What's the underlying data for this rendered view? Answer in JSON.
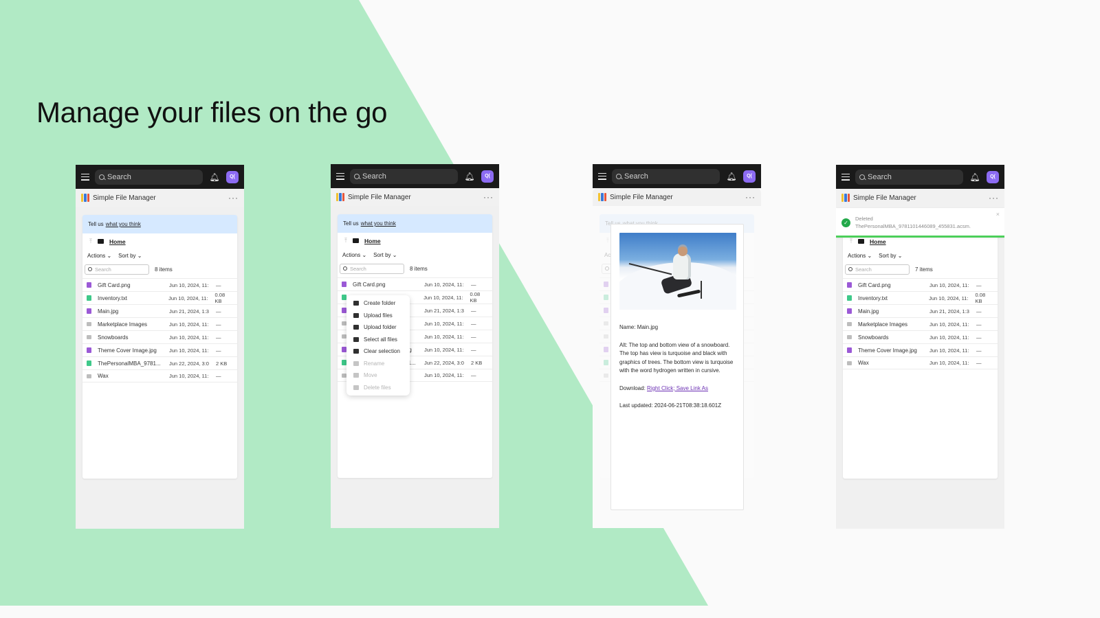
{
  "page": {
    "headline": "Manage your files on the go",
    "colors": {
      "green": "#b1eac5",
      "background": "#fafafa",
      "accent": "#8c6bf2",
      "success": "#23a94a"
    }
  },
  "common": {
    "search_placeholder": "Search",
    "avatar_initials": "Q(",
    "app_name": "Simple File Manager",
    "more_label": "···",
    "banner_prefix": "Tell us",
    "banner_link": "what you think",
    "breadcrumb_home": "Home",
    "actions_label": "Actions ⌄",
    "sort_label": "Sort by ⌄",
    "list_search_placeholder": "Search",
    "icons": {
      "menu": "hamburger-icon",
      "search": "search-icon",
      "bell": "bell-icon",
      "up": "up-arrow-icon",
      "folder": "folder-icon",
      "more": "more-icon"
    }
  },
  "screens": [
    {
      "id": "file-list",
      "item_count": "8 items",
      "files": [
        {
          "name": "Gift Card.png",
          "type": "img",
          "date": "Jun 10, 2024, 11:",
          "size": "—"
        },
        {
          "name": "Inventory.txt",
          "type": "txt",
          "date": "Jun 10, 2024, 11:",
          "size": "0.08 KB"
        },
        {
          "name": "Main.jpg",
          "type": "img",
          "date": "Jun 21, 2024, 1:3",
          "size": "—"
        },
        {
          "name": "Marketplace Images",
          "type": "folder",
          "date": "Jun 10, 2024, 11:",
          "size": "—"
        },
        {
          "name": "Snowboards",
          "type": "folder",
          "date": "Jun 10, 2024, 11:",
          "size": "—"
        },
        {
          "name": "Theme Cover Image.jpg",
          "type": "img",
          "date": "Jun 10, 2024, 11:",
          "size": "—"
        },
        {
          "name": "ThePersonalMBA_9781...",
          "type": "doc",
          "date": "Jun 22, 2024, 3:0",
          "size": "2 KB"
        },
        {
          "name": "Wax",
          "type": "folder",
          "date": "Jun 10, 2024, 11:",
          "size": "—"
        }
      ]
    },
    {
      "id": "actions-menu",
      "item_count": "8 items",
      "menu": [
        {
          "label": "Create folder",
          "icon": "create-folder-icon",
          "disabled": false
        },
        {
          "label": "Upload files",
          "icon": "upload-icon",
          "disabled": false
        },
        {
          "label": "Upload folder",
          "icon": "upload-icon",
          "disabled": false
        },
        {
          "label": "Select all files",
          "icon": "select-all-icon",
          "disabled": false
        },
        {
          "label": "Clear selection",
          "icon": "eraser-icon",
          "disabled": false
        },
        {
          "label": "Rename",
          "icon": "rename-icon",
          "disabled": true
        },
        {
          "label": "Move",
          "icon": "move-icon",
          "disabled": true
        },
        {
          "label": "Delete files",
          "icon": "trash-icon",
          "disabled": true
        }
      ]
    },
    {
      "id": "file-details",
      "details": {
        "name": "Name: Main.jpg",
        "alt": "Alt: The top and bottom view of a snowboard. The top has view is turquoise and black with graphics of trees. The bottom view is turquoise with the word hydrogen written in cursive.",
        "download_prefix": "Download:",
        "download_link": "Right Click; Save Link As",
        "last_updated": "Last updated: 2024-06-21T08:38:18.601Z",
        "image_alt": "Skier carving down a snowy slope"
      }
    },
    {
      "id": "deleted-toast",
      "item_count": "7 items",
      "toast": {
        "title": "Deleted",
        "message": "ThePersonalMBA_9781101446089_455831.acsm.",
        "close": "×"
      }
    }
  ]
}
